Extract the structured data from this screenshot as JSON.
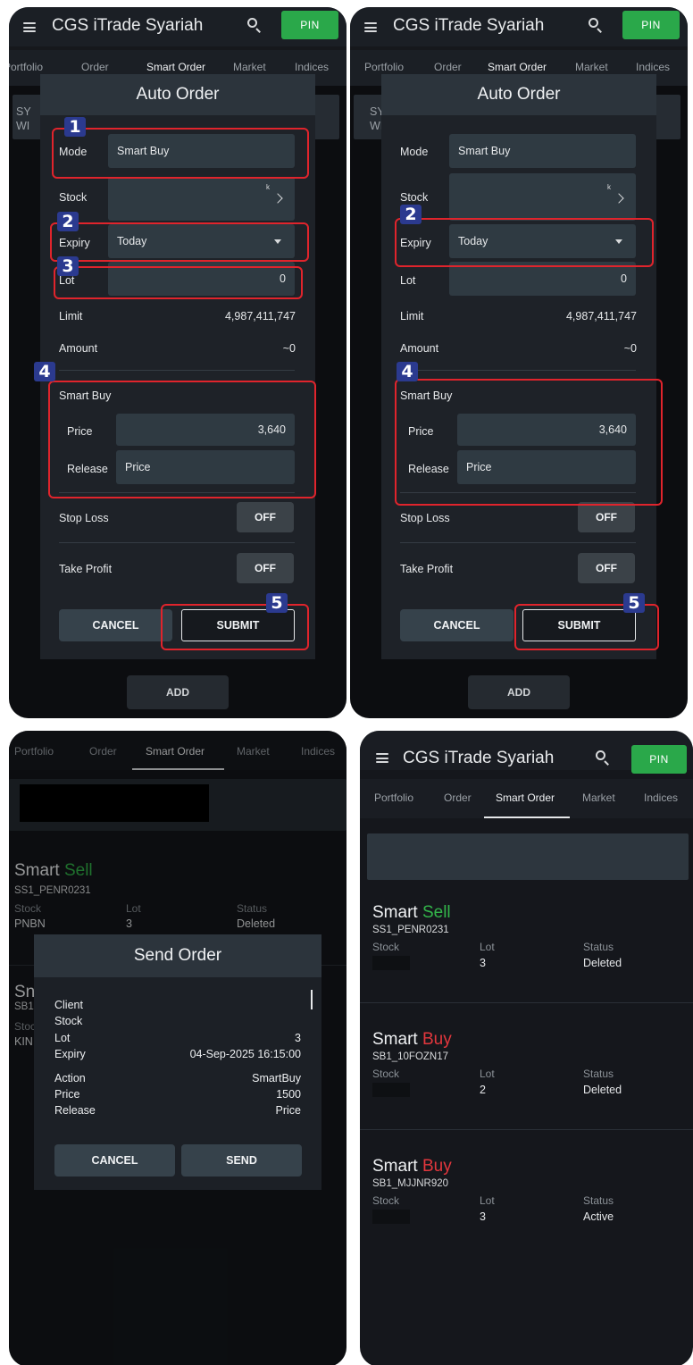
{
  "app": {
    "title": "CGS iTrade Syariah",
    "pin_label": "PIN"
  },
  "tabs": [
    "Portfolio",
    "Order",
    "Smart Order",
    "Market",
    "Indices"
  ],
  "auto_order": {
    "title": "Auto Order",
    "mode_label": "Mode",
    "mode_value": "Smart Buy",
    "stock_label": "Stock",
    "stock_hint": "k",
    "expiry_label": "Expiry",
    "expiry_value": "Today",
    "lot_label": "Lot",
    "lot_value": "0",
    "limit_label": "Limit",
    "limit_value": "4,987,411,747",
    "amount_label": "Amount",
    "amount_value": "~0",
    "section_title": "Smart Buy",
    "price_label": "Price",
    "price_value": "3,640",
    "release_label": "Release",
    "release_value": "Price",
    "stop_loss_label": "Stop Loss",
    "stop_loss_value": "OFF",
    "take_profit_label": "Take Profit",
    "take_profit_value": "OFF",
    "cancel_label": "CANCEL",
    "submit_label": "SUBMIT",
    "add_label": "ADD",
    "bg_fragment_1": "SY",
    "bg_fragment_2": "WI"
  },
  "badges": {
    "b1": "1",
    "b2": "2",
    "b3": "3",
    "b4": "4",
    "b5": "5"
  },
  "send_order": {
    "title": "Send Order",
    "rows": [
      {
        "label": "Client",
        "value": ""
      },
      {
        "label": "Stock",
        "value": ""
      },
      {
        "label": "Lot",
        "value": "3"
      },
      {
        "label": "Expiry",
        "value": "04-Sep-2025 16:15:00"
      },
      {
        "label": "Action",
        "value": "SmartBuy"
      },
      {
        "label": "Price",
        "value": "1500"
      },
      {
        "label": "Release",
        "value": "Price"
      }
    ],
    "cancel_label": "CANCEL",
    "send_label": "SEND"
  },
  "bg_list": {
    "order1_prefix": "Smart",
    "order1_side": "Sell",
    "order1_id": "SS1_PENR0231",
    "stock_head": "Stock",
    "lot_head": "Lot",
    "status_head": "Status",
    "order1_stock": "PNBN",
    "order1_lot": "3",
    "order1_status": "Deleted",
    "order2_prefix": "Sn",
    "order2_id": "SB1",
    "order2_stock_head": "Stoc",
    "order2_stock": "KIN"
  },
  "orders": [
    {
      "prefix": "Smart",
      "side": "Sell",
      "id": "SS1_PENR0231",
      "lot": "3",
      "status": "Deleted"
    },
    {
      "prefix": "Smart",
      "side": "Buy",
      "id": "SB1_10FOZN17",
      "lot": "2",
      "status": "Deleted"
    },
    {
      "prefix": "Smart",
      "side": "Buy",
      "id": "SB1_MJJNR920",
      "lot": "3",
      "status": "Active"
    }
  ],
  "order_heads": {
    "stock": "Stock",
    "lot": "Lot",
    "status": "Status"
  },
  "colors": {
    "sell": "#33b54a",
    "buy": "#e2373d",
    "pin": "#2aa84a",
    "highlight": "#e0242c",
    "badge": "#2b3a8f"
  }
}
